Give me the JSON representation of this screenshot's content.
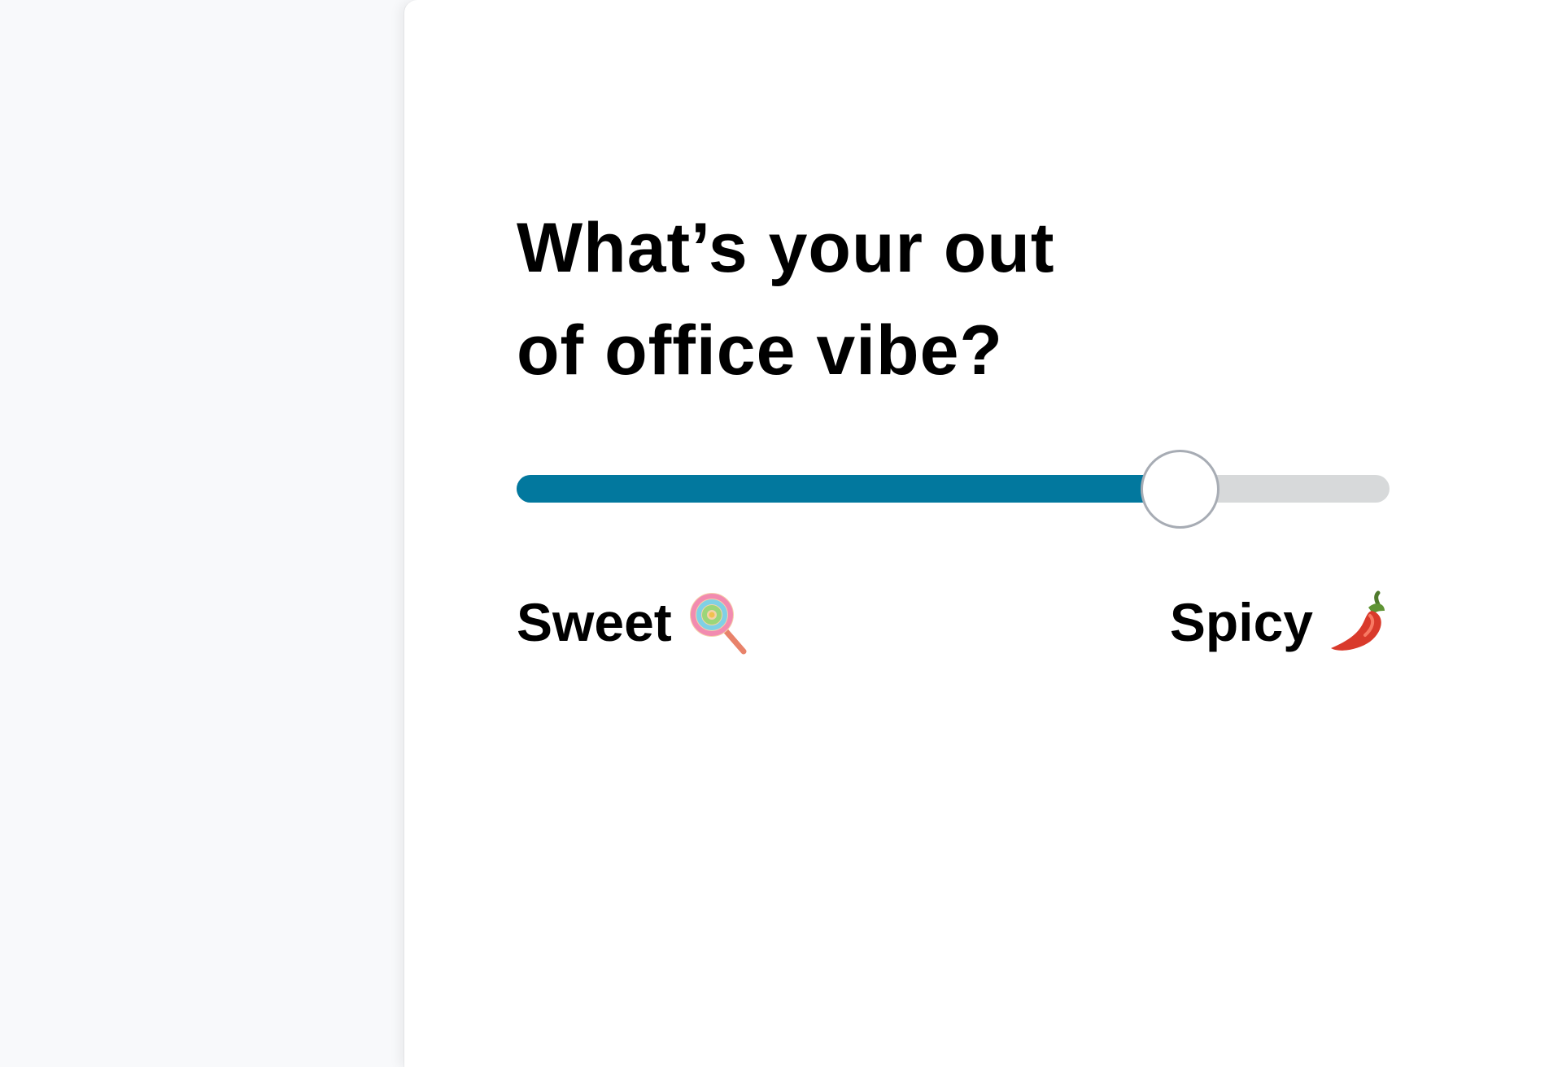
{
  "question": {
    "line1": "What’s your out",
    "line2": "of office vibe?"
  },
  "slider": {
    "value_fraction": 0.76,
    "fill_color": "#02789e",
    "track_color": "#d7d9da",
    "thumb_border_color": "#a7acb4"
  },
  "labels": {
    "left": "Sweet",
    "left_icon": "lollipop-icon",
    "right": "Spicy",
    "right_icon": "hot-pepper-icon"
  }
}
